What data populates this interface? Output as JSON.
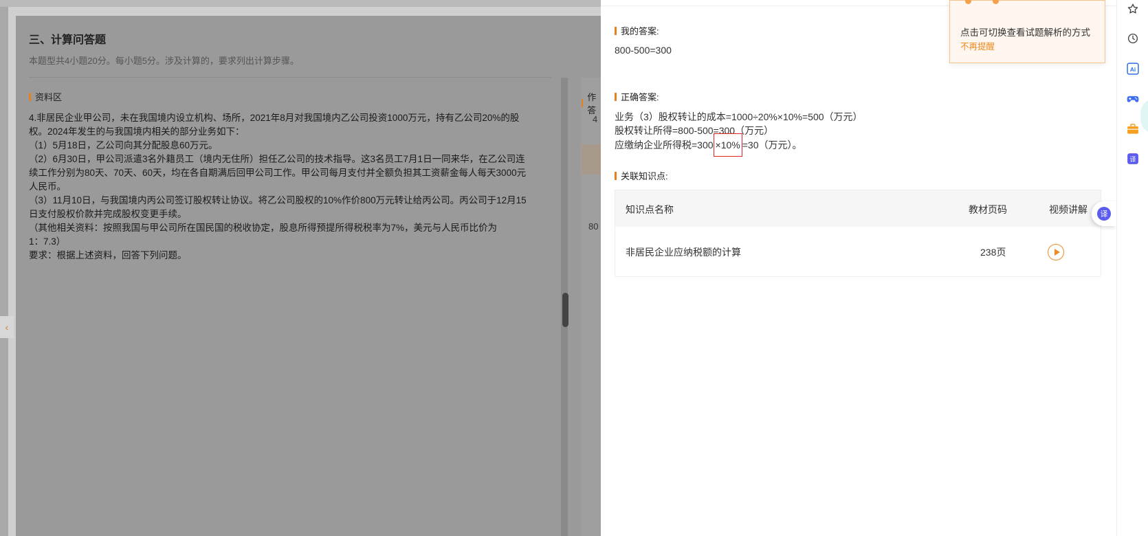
{
  "left": {
    "section_title": "三、计算问答题",
    "section_desc": "本题型共4小题20分。每小题5分。涉及计算的，要求列出计算步骤。",
    "material_label": "资料区",
    "material_lines": [
      "4.非居民企业甲公司，未在我国境内设立机构、场所，2021年8月对我国境内乙公司投资1000万元，持有乙公司20%的股",
      "权。2024年发生的与我国境内相关的部分业务如下：",
      "（1）5月18日，乙公司向其分配股息60万元。",
      "（2）6月30日，甲公司派遣3名外籍员工（境内无住所）担任乙公司的技术指导。这3名员工7月1日一同来华，在乙公司连",
      "续工作分别为80天、70天、60天，均在各自期满后回甲公司工作。甲公司每月支付并全额负担其工资薪金每人每天3000元",
      "人民币。",
      "（3）11月10日，与我国境内丙公司签订股权转让协议。将乙公司股权的10%作价800万元转让给丙公司。丙公司于12月15",
      "日支付股权价款并完成股权变更手续。",
      "（其他相关资料：按照我国与甲公司所在国民国的税收协定，股息所得预提所得税税率为7%，美元与人民币比价为",
      "1：7.3）",
      "要求：根据上述资料，回答下列问题。"
    ],
    "answer_area_label": "作答",
    "peek_1": "4",
    "peek_2": "80",
    "collapse_arrow": "‹"
  },
  "drawer": {
    "my_answer_label": "我的答案:",
    "my_answer_value": "800-500=300",
    "correct_label": "正确答案:",
    "correct_line_1": "业务（3）股权转让的成本=1000÷20%×10%=500（万元）",
    "correct_line_2": "股权转让所得=800-500=300（万元）",
    "correct_line_3_pre": "应缴纳企业所得税=300",
    "correct_line_3_hl": "×10%",
    "correct_line_3_post": "=30（万元）。",
    "related_label": "关联知识点:",
    "table": {
      "headers": [
        "知识点名称",
        "教材页码",
        "视频讲解"
      ],
      "rows": [
        {
          "name": "非居民企业应纳税额的计算",
          "page": "238页"
        }
      ]
    },
    "tip_text": "点击可切换查看试题解析的方式",
    "tip_dismiss": "不再提醒",
    "translate_glyph": "译"
  },
  "rail": {
    "icons": [
      "star-icon",
      "history-icon",
      "ai-icon",
      "game-icon",
      "toolbox-icon",
      "translate-icon"
    ],
    "ai_text": "Ai",
    "translate_text": "译"
  },
  "colors": {
    "accent": "#e5801f",
    "highlight_border": "#e02424",
    "translate": "#5b5bf0"
  }
}
